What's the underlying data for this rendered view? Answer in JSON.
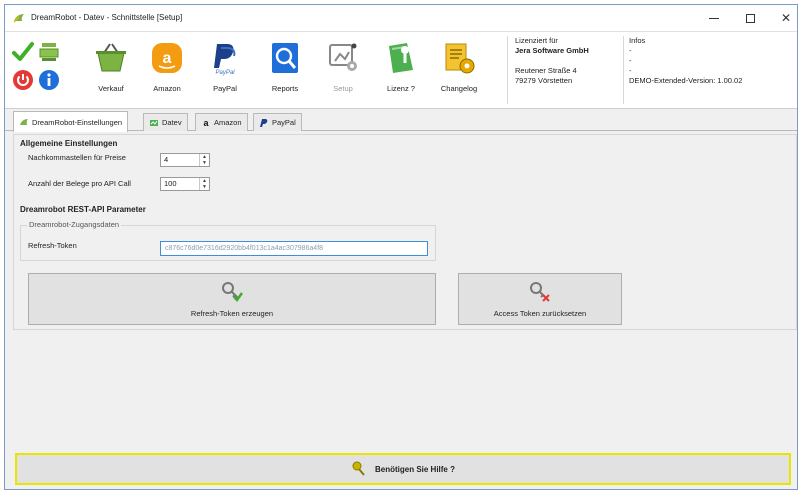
{
  "window": {
    "title": "DreamRobot - Datev - Schnittstelle [Setup]",
    "controls": {
      "minimize": "minimize",
      "maximize": "maximize",
      "close": "✕"
    }
  },
  "toolbar": {
    "quick_icons": [
      "check-icon",
      "cash-register-icon",
      "power-icon",
      "info-icon"
    ],
    "buttons": [
      {
        "label": "Verkauf",
        "icon": "shopping-basket-icon"
      },
      {
        "label": "Amazon",
        "icon": "amazon-icon"
      },
      {
        "label": "PayPal",
        "icon": "paypal-icon"
      },
      {
        "label": "Reports",
        "icon": "reports-icon"
      },
      {
        "label": "Setup",
        "icon": "setup-icon",
        "disabled": true
      },
      {
        "label": "Lizenz ?",
        "icon": "license-icon"
      },
      {
        "label": "Changelog",
        "icon": "changelog-icon"
      }
    ],
    "license": {
      "heading": "Lizenziert für",
      "company": "Jera Software GmbH",
      "street": "Reutener Straße 4",
      "city": "79279 Vörstetten"
    },
    "infos": {
      "heading": "Infos",
      "lines": [
        "-",
        "-",
        "-",
        "DEMO-Extended-Version: 1.00.02"
      ]
    }
  },
  "tabs": [
    {
      "label": "DreamRobot-Einstellungen",
      "active": true
    },
    {
      "label": "Datev",
      "active": false
    },
    {
      "label": "Amazon",
      "active": false
    },
    {
      "label": "PayPal",
      "active": false
    }
  ],
  "settings": {
    "general_title": "Allgemeine Einstellungen",
    "decimals_label": "Nachkommastellen für Preise",
    "decimals_value": "4",
    "receipts_label": "Anzahl der Belege pro API Call",
    "receipts_value": "100",
    "api_title": "Dreamrobot REST-API Parameter",
    "access_legend": "Dreamrobot-Zugangsdaten",
    "token_label": "Refresh-Token",
    "token_value": "c876c76d0e7316d2920bb4f013c1a4ac307986a4f8",
    "refresh_button": "Refresh-Token erzeugen",
    "reset_button": "Access Token zurücksetzen"
  },
  "help_button": "Benötigen Sie Hilfe ?",
  "colors": {
    "accent_blue": "#3c8fd8",
    "help_border": "#e6e600",
    "button_face": "#e1e1e1"
  }
}
